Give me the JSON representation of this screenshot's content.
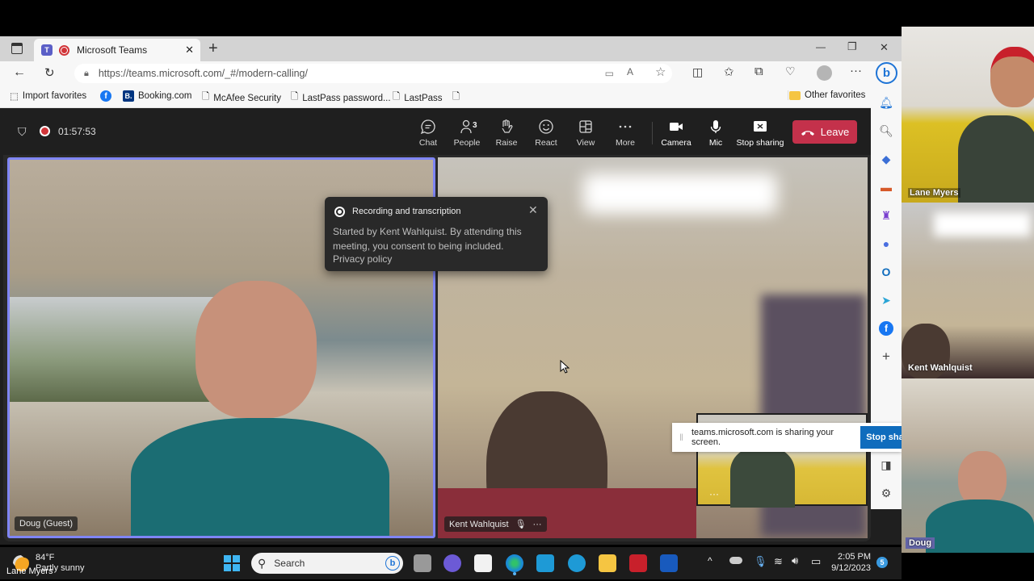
{
  "browser": {
    "tab_title": "Microsoft Teams",
    "new_tab": "+",
    "url": "https://teams.microsoft.com/_#/modern-calling/",
    "url_host": "teams.microsoft.com",
    "favorites": [
      "Import favorites",
      "Booking.com",
      "McAfee Security",
      "LastPass password...",
      "LastPass"
    ],
    "other_favorites": "Other favorites",
    "min": "—",
    "restore": "❐",
    "close": "✕"
  },
  "meeting": {
    "timer": "01:57:53",
    "people_count": "3",
    "toolbar": [
      "Chat",
      "People",
      "Raise",
      "React",
      "View",
      "More",
      "Camera",
      "Mic",
      "Stop sharing"
    ],
    "leave": "Leave",
    "accent": "#c4314b"
  },
  "toast": {
    "title": "Recording and transcription",
    "body": "Started by Kent Wahlquist. By attending this meeting, you consent to being included.",
    "link": "Privacy policy"
  },
  "tiles": {
    "left": "Doug (Guest)",
    "right": "Kent Wahlquist"
  },
  "sharebar": {
    "text": "teams.microsoft.com is sharing your screen.",
    "button": "Stop sha"
  },
  "taskbar": {
    "temp": "84°F",
    "weather": "Partly sunny",
    "search": "Search",
    "time": "2:05 PM",
    "date": "9/12/2023",
    "badge": "5"
  },
  "participants": [
    "Lane Myers",
    "Kent Wahlquist",
    "Doug"
  ],
  "footer_name": "Lane Myers"
}
